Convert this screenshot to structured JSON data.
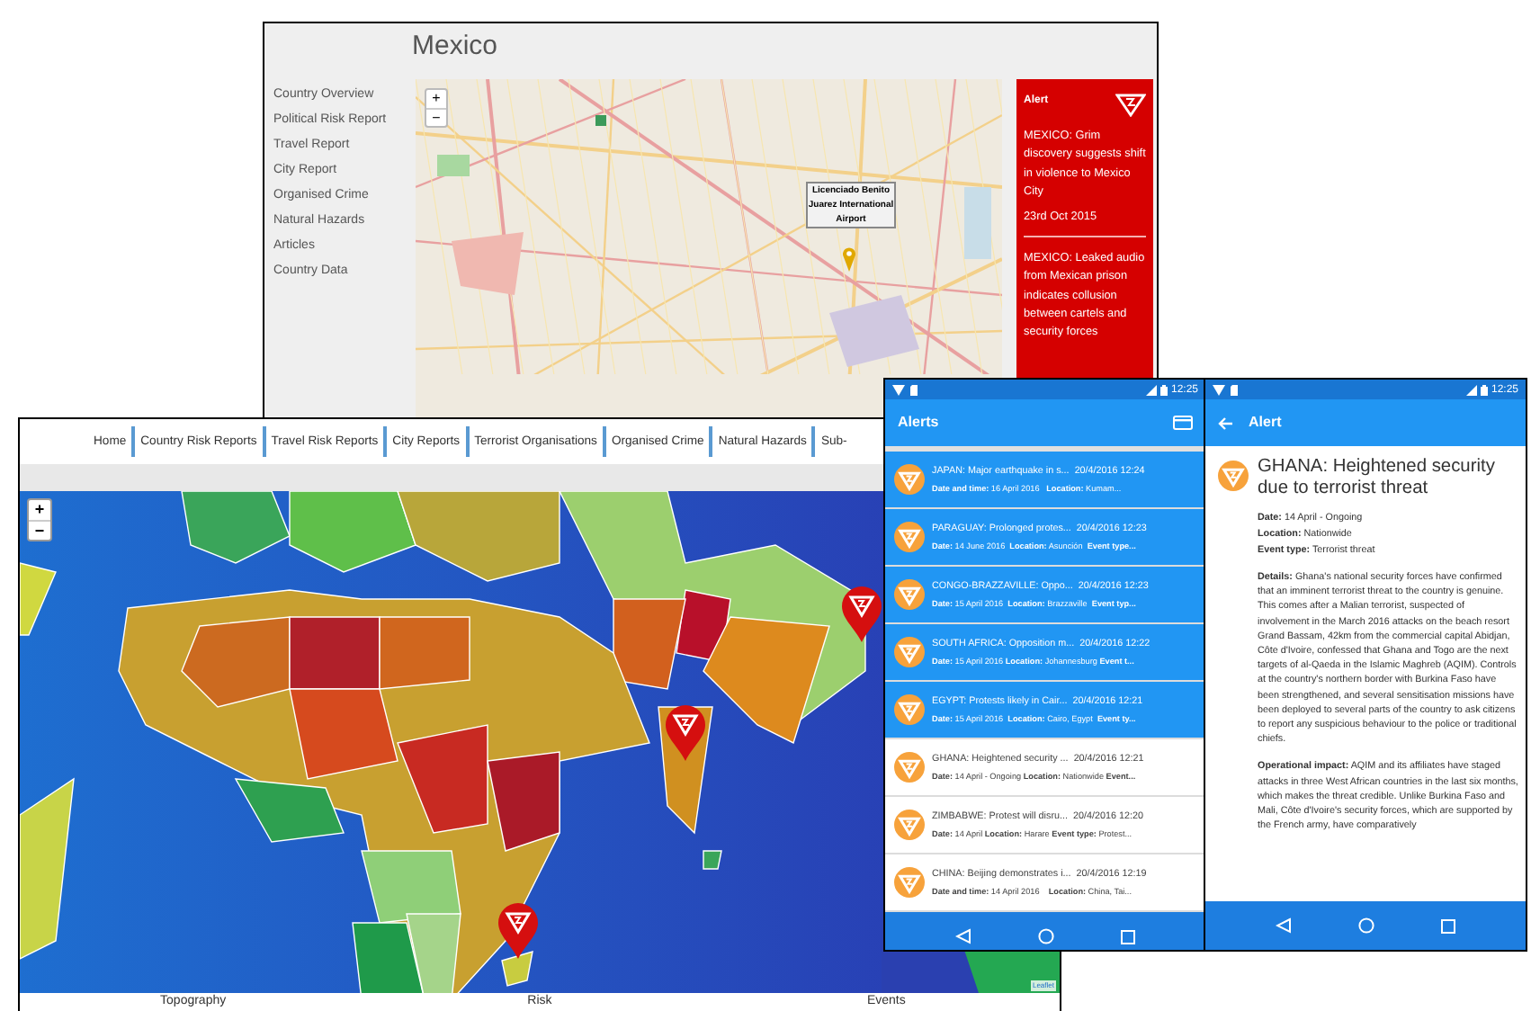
{
  "country_page": {
    "title": "Mexico",
    "sidebar": [
      "Country Overview",
      "Political Risk Report",
      "Travel Report",
      "City Report",
      "Organised Crime",
      "Natural Hazards",
      "Articles",
      "Country Data"
    ],
    "map": {
      "zoom_in": "+",
      "zoom_out": "−",
      "popup": "Licenciado Benito Juarez International Airport"
    },
    "alert": {
      "title": "Alert",
      "items": [
        {
          "headline": "MEXICO: Grim discovery suggests shift in violence to Mexico City",
          "date": "23rd Oct 2015"
        },
        {
          "headline": "MEXICO: Leaked audio from Mexican prison indicates collusion between cartels and security forces"
        }
      ]
    }
  },
  "risk_page": {
    "nav": [
      "Home",
      "Country Risk Reports",
      "Travel Risk Reports",
      "City Reports",
      "Terrorist Organisations",
      "Organised Crime",
      "Natural Hazards",
      "Sub-"
    ],
    "map": {
      "zoom_in": "+",
      "zoom_out": "−",
      "attribution": "Leaflet"
    },
    "map_tabs": [
      "Topography",
      "Risk",
      "Events"
    ]
  },
  "alerts_app": {
    "status_time": "12:25",
    "title": "Alerts",
    "items": [
      {
        "headline": "JAPAN: Major earthquake in s...",
        "time": "20/4/2016 12:24",
        "meta": "**Date and time:** 16 April 2016   **Location:** Kumam...",
        "selected": true
      },
      {
        "headline": "PARAGUAY: Prolonged protes...",
        "time": "20/4/2016 12:23",
        "meta": "**Date:** 14 June 2016  **Location:** Asunción  **Event type...**",
        "selected": true
      },
      {
        "headline": "CONGO-BRAZZAVILLE: Oppo...",
        "time": "20/4/2016 12:23",
        "meta": "**Date:** 15 April 2016  **Location:** Brazzaville  **Event typ...**",
        "selected": true
      },
      {
        "headline": "SOUTH AFRICA: Opposition m...",
        "time": "20/4/2016 12:22",
        "meta": "**Date:** 15 April 2016 **Location:** Johannesburg **Event t...**",
        "selected": true
      },
      {
        "headline": "EGYPT: Protests likely in Cair...",
        "time": "20/4/2016 12:21",
        "meta": "**Date:** 15 April 2016  **Location:** Cairo, Egypt  **Event ty...**",
        "selected": true
      },
      {
        "headline": "GHANA: Heightened security ...",
        "time": "20/4/2016 12:21",
        "meta": "**Date:** 14 April - Ongoing **Location:** Nationwide **Event...**",
        "selected": false
      },
      {
        "headline": "ZIMBABWE: Protest will disru...",
        "time": "20/4/2016 12:20",
        "meta": "**Date:** 14 April **Location:** Harare **Event type:** Protest...",
        "selected": false
      },
      {
        "headline": "CHINA: Beijing demonstrates i...",
        "time": "20/4/2016 12:19",
        "meta": "**Date and time:** 14 April 2016    **Location:** China, Tai...",
        "selected": false
      }
    ]
  },
  "alert_detail": {
    "status_time": "12:25",
    "title": "Alert",
    "headline": "GHANA: Heightened security due to terrorist threat",
    "fields": [
      "**Date:** 14 April - Ongoing",
      "**Location:** Nationwide",
      "**Event type:** Terrorist threat"
    ],
    "paragraphs": [
      "**Details:** Ghana's national security forces have confirmed that an imminent terrorist threat to the country is genuine. This comes after a Malian terrorist, suspected of involvement in the March 2016 attacks on the beach resort Grand Bassam, 42km from the commercial capital Abidjan, Côte d'Ivoire, confessed that Ghana and Togo are the next targets of al-Qaeda in the Islamic Maghreb (AQIM). Controls at the country's northern border with Burkina Faso have been strengthened, and several sensitisation missions have been deployed to several parts of the country to ask citizens to report any suspicious behaviour to the police or traditional chiefs.",
      "**Operational impact:**  AQIM and its affiliates have staged attacks in three West African countries in the last six months, which makes the threat credible. Unlike Burkina Faso and Mali, Côte d'Ivoire's security forces, which are supported by the French army, have comparatively"
    ]
  }
}
